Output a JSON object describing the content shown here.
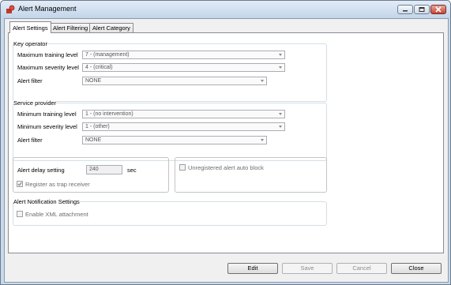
{
  "window": {
    "title": "Alert Management"
  },
  "tabs": [
    {
      "label": "Alert Settings"
    },
    {
      "label": "Alert Filtering"
    },
    {
      "label": "Alert Category"
    }
  ],
  "key_operator": {
    "title": "Key operator",
    "max_training_label": "Maximum training level",
    "max_training_value": "7 - (management)",
    "max_severity_label": "Maximum severity level",
    "max_severity_value": "4 - (critical)",
    "filter_label": "Alert filter",
    "filter_value": "NONE"
  },
  "service_provider": {
    "title": "Service provider",
    "min_training_label": "Minimum training level",
    "min_training_value": "1 - (no intervention)",
    "min_severity_label": "Minimum severity level",
    "min_severity_value": "1 - (other)",
    "filter_label": "Alert filter",
    "filter_value": "NONE"
  },
  "delay": {
    "label": "Alert delay setting",
    "value": "240",
    "unit": "sec",
    "trap_label": "Register as trap receiver",
    "trap_checked": true
  },
  "unregistered": {
    "label": "Unregistered alert auto block",
    "checked": false
  },
  "notification": {
    "title": "Alert Notification Settings",
    "xml_label": "Enable XML attachment",
    "xml_checked": false
  },
  "buttons": {
    "edit": "Edit",
    "save": "Save",
    "cancel": "Cancel",
    "close": "Close"
  }
}
